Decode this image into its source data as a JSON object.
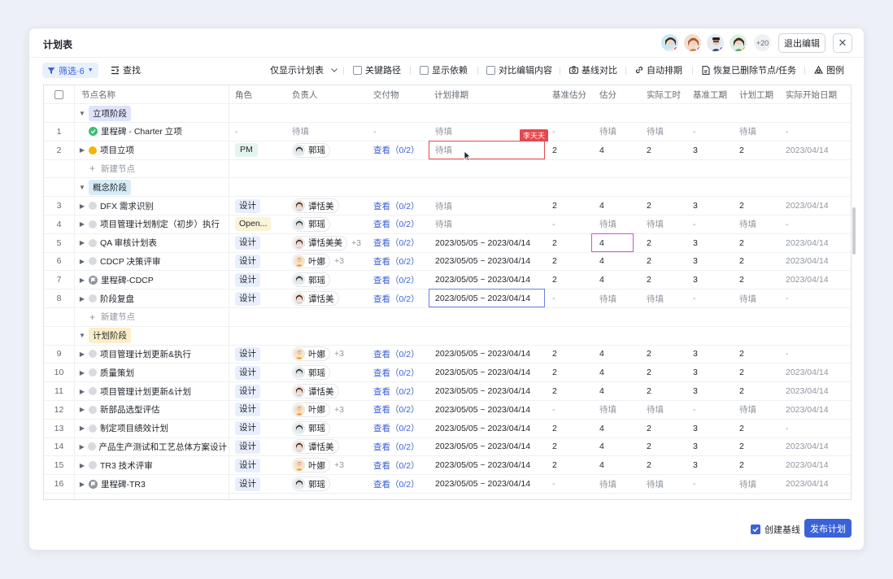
{
  "header": {
    "title": "计划表",
    "more_count": "+20",
    "exit_label": "退出编辑",
    "close_symbol": "✕"
  },
  "toolbar": {
    "filter_label": "筛选·6",
    "search_label": "查找",
    "view_label": "仅显示计划表",
    "critical_path": "关键路径",
    "show_deps": "显示依赖",
    "compare_edit": "对比编辑内容",
    "baseline_compare": "基线对比",
    "auto_schedule": "自动排期",
    "restore_deleted": "恢复已删除节点/任务",
    "legend": "图例"
  },
  "columns": [
    "节点名称",
    "角色",
    "负责人",
    "交付物",
    "计划排期",
    "基准估分",
    "估分",
    "实际工时",
    "基准工期",
    "计划工期",
    "实际开始日期"
  ],
  "new_node_label": "新建节点",
  "red_cell_user": "李天天",
  "rows": [
    {
      "kind": "stage",
      "name": "立项阶段",
      "color": "#dfe3fb"
    },
    {
      "kind": "task",
      "idx": "1",
      "name": "里程碑 - Charter 立项",
      "icon": "milestone-green",
      "role": "-",
      "owner": "待填",
      "deliverable": "-",
      "schedule": "待填",
      "base_est": "-",
      "est": "待填",
      "actual": "待填",
      "base_dur": "-",
      "plan_dur": "待填",
      "start": "-",
      "nochev": true
    },
    {
      "kind": "task",
      "idx": "2",
      "name": "项目立项",
      "icon": "dot-yellow",
      "role": "PM",
      "owner": "郭瑶",
      "owner_extra": "",
      "deliverable": "查看（0/2）",
      "schedule": "待填",
      "base_est": "2",
      "est": "4",
      "actual": "2",
      "base_dur": "3",
      "plan_dur": "2",
      "start": "2023/04/14"
    },
    {
      "kind": "add"
    },
    {
      "kind": "stage",
      "name": "概念阶段",
      "color": "#d7ecf7"
    },
    {
      "kind": "task",
      "idx": "3",
      "name": "DFX 需求识别",
      "icon": "dot-gray",
      "role": "设计",
      "owner": "谭恬美",
      "owner_extra": "",
      "deliverable": "查看（0/2）",
      "schedule": "待填",
      "base_est": "2",
      "est": "4",
      "actual": "2",
      "base_dur": "3",
      "plan_dur": "2",
      "start": "2023/04/14"
    },
    {
      "kind": "task",
      "idx": "4",
      "name": "项目管理计划制定（初步）执行",
      "icon": "dot-gray",
      "role": "Open...",
      "owner": "郭瑶",
      "owner_extra": "",
      "deliverable": "查看（0/2）",
      "schedule": "待填",
      "base_est": "-",
      "est": "待填",
      "actual": "待填",
      "base_dur": "-",
      "plan_dur": "待填",
      "start": "-"
    },
    {
      "kind": "task",
      "idx": "5",
      "name": "QA 审核计划表",
      "icon": "dot-gray",
      "role": "设计",
      "owner": "谭恬美美",
      "owner_extra": "+3",
      "deliverable": "查看（0/2）",
      "schedule": "2023/05/05 ~ 2023/04/14",
      "base_est": "2",
      "est": "4",
      "actual": "2",
      "base_dur": "3",
      "plan_dur": "2",
      "start": "2023/04/14"
    },
    {
      "kind": "task",
      "idx": "6",
      "name": "CDCP 决策评审",
      "icon": "dot-gray",
      "role": "设计",
      "owner": "叶娜",
      "owner_extra": "+3",
      "deliverable": "查看（0/2）",
      "schedule": "2023/05/05 ~ 2023/04/14",
      "base_est": "2",
      "est": "4",
      "actual": "2",
      "base_dur": "3",
      "plan_dur": "2",
      "start": "2023/04/14"
    },
    {
      "kind": "task",
      "idx": "7",
      "name": "里程碑-CDCP",
      "icon": "milestone-gray",
      "role": "设计",
      "owner": "郭瑶",
      "owner_extra": "",
      "deliverable": "查看（0/2）",
      "schedule": "2023/05/05 ~ 2023/04/14",
      "base_est": "2",
      "est": "4",
      "actual": "2",
      "base_dur": "3",
      "plan_dur": "2",
      "start": "2023/04/14"
    },
    {
      "kind": "task",
      "idx": "8",
      "name": "阶段复盘",
      "icon": "dot-gray",
      "role": "设计",
      "owner": "谭恬美",
      "owner_extra": "",
      "deliverable": "查看（0/2）",
      "schedule": "2023/05/05 ~ 2023/04/14",
      "base_est": "-",
      "est": "待填",
      "actual": "待填",
      "base_dur": "-",
      "plan_dur": "待填",
      "start": "-"
    },
    {
      "kind": "add"
    },
    {
      "kind": "stage",
      "name": "计划阶段",
      "color": "#fbefc9"
    },
    {
      "kind": "task",
      "idx": "9",
      "name": "项目管理计划更新&执行",
      "icon": "dot-gray",
      "role": "设计",
      "owner": "叶娜",
      "owner_extra": "+3",
      "deliverable": "查看（0/2）",
      "schedule": "2023/05/05 ~ 2023/04/14",
      "base_est": "2",
      "est": "4",
      "actual": "2",
      "base_dur": "3",
      "plan_dur": "2",
      "start": "-"
    },
    {
      "kind": "task",
      "idx": "10",
      "name": "质量策划",
      "icon": "dot-gray",
      "role": "设计",
      "owner": "郭瑶",
      "owner_extra": "",
      "deliverable": "查看（0/2）",
      "schedule": "2023/05/05 ~ 2023/04/14",
      "base_est": "2",
      "est": "4",
      "actual": "2",
      "base_dur": "3",
      "plan_dur": "2",
      "start": "2023/04/14"
    },
    {
      "kind": "task",
      "idx": "11",
      "name": "项目管理计划更新&计划",
      "icon": "dot-gray",
      "role": "设计",
      "owner": "谭恬美",
      "owner_extra": "",
      "deliverable": "查看（0/2）",
      "schedule": "2023/05/05 ~ 2023/04/14",
      "base_est": "2",
      "est": "4",
      "actual": "2",
      "base_dur": "3",
      "plan_dur": "2",
      "start": "2023/04/14"
    },
    {
      "kind": "task",
      "idx": "12",
      "name": "新部品选型评估",
      "icon": "dot-gray",
      "role": "设计",
      "owner": "叶娜",
      "owner_extra": "+3",
      "deliverable": "查看（0/2）",
      "schedule": "2023/05/05 ~ 2023/04/14",
      "base_est": "-",
      "est": "待填",
      "actual": "待填",
      "base_dur": "-",
      "plan_dur": "待填",
      "start": "2023/04/14"
    },
    {
      "kind": "task",
      "idx": "13",
      "name": "制定项目绩效计划",
      "icon": "dot-gray",
      "role": "设计",
      "owner": "郭瑶",
      "owner_extra": "",
      "deliverable": "查看（0/2）",
      "schedule": "2023/05/05 ~ 2023/04/14",
      "base_est": "2",
      "est": "4",
      "actual": "2",
      "base_dur": "3",
      "plan_dur": "2",
      "start": "-"
    },
    {
      "kind": "task",
      "idx": "14",
      "name": "产品生产测试和工艺总体方案设计",
      "icon": "dot-gray",
      "role": "设计",
      "owner": "谭恬美",
      "owner_extra": "",
      "deliverable": "查看（0/2）",
      "schedule": "2023/05/05 ~ 2023/04/14",
      "base_est": "2",
      "est": "4",
      "actual": "2",
      "base_dur": "3",
      "plan_dur": "2",
      "start": "2023/04/14"
    },
    {
      "kind": "task",
      "idx": "15",
      "name": "TR3 技术评审",
      "icon": "dot-gray",
      "role": "设计",
      "owner": "叶娜",
      "owner_extra": "+3",
      "deliverable": "查看（0/2）",
      "schedule": "2023/05/05 ~ 2023/04/14",
      "base_est": "2",
      "est": "4",
      "actual": "2",
      "base_dur": "3",
      "plan_dur": "2",
      "start": "2023/04/14"
    },
    {
      "kind": "task",
      "idx": "16",
      "name": "里程碑-TR3",
      "icon": "milestone-gray",
      "role": "设计",
      "owner": "郭瑶",
      "owner_extra": "",
      "deliverable": "查看（0/2）",
      "schedule": "2023/05/05 ~ 2023/04/14",
      "base_est": "-",
      "est": "待填",
      "actual": "待填",
      "base_dur": "-",
      "plan_dur": "待填",
      "start": "2023/04/14"
    }
  ],
  "footer": {
    "baseline_label": "创建基线",
    "publish_label": "发布计划"
  },
  "colors": {
    "accent": "#3b63d8",
    "red": "#e5484d",
    "magenta": "#d84fd4"
  }
}
